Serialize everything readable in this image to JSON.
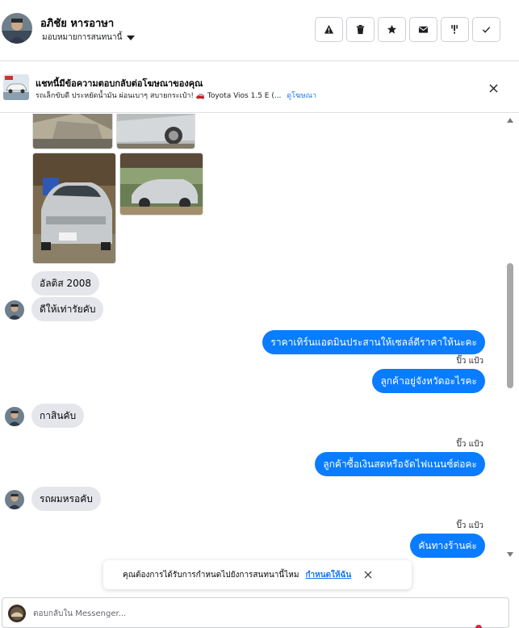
{
  "header": {
    "contact_name": "อภิชัย หารอาษา",
    "assign_label": "มอบหมายการสนทนานี้",
    "tools": [
      {
        "icon": "warning-icon",
        "name": "report-spam-button"
      },
      {
        "icon": "trash-icon",
        "name": "delete-button"
      },
      {
        "icon": "star-icon",
        "name": "star-button"
      },
      {
        "icon": "envelope-icon",
        "name": "mark-unread-button"
      },
      {
        "icon": "follow-up-icon",
        "name": "follow-up-button"
      },
      {
        "icon": "check-icon",
        "name": "mark-done-button"
      }
    ]
  },
  "ad_banner": {
    "title": "แชทนี้มีข้อความตอบกลับต่อโฆษณาของคุณ",
    "subtitle": "รถเล็กขับดี ประหยัดน้ำมัน ผ่อนเบาๆ สบายกระเป๋า! 🚗 Toyota Vios 1.5 E (...",
    "link": "ดูโฆษณา"
  },
  "messages": [
    {
      "text": "อัลติส 2008"
    },
    {
      "text": "ดีให้เท่ารัยคับ"
    },
    {
      "text": "ราคาเทิร์นแอดมินประสานให้เซลล์ดีราคาให้นะคะ"
    },
    {
      "sender": "ปิ๊ว แป้ว",
      "text": "ลูกค้าอยู่จังหวัดอะไรคะ"
    },
    {
      "text": "กาสินคับ"
    },
    {
      "sender": "ปิ๊ว แป้ว",
      "text": "ลูกค้าซื้อเงินสดหรือจัดไฟแนนซ์ต่อคะ"
    },
    {
      "text": "รถผมหรอคับ"
    },
    {
      "sender": "ปิ๊ว แป้ว",
      "text": "คันทางร้านค่ะ"
    }
  ],
  "toast": {
    "text": "คุณต้องการได้รับการกำหนดไปยังการสนทนานี้ไหม",
    "link": "กำหนดให้ฉัน"
  },
  "composer": {
    "placeholder": "ตอบกลับใน Messenger..."
  },
  "colors": {
    "outgoing_bubble": "#0a7cff",
    "incoming_bubble": "#e4e6eb",
    "link": "#1877f2"
  }
}
